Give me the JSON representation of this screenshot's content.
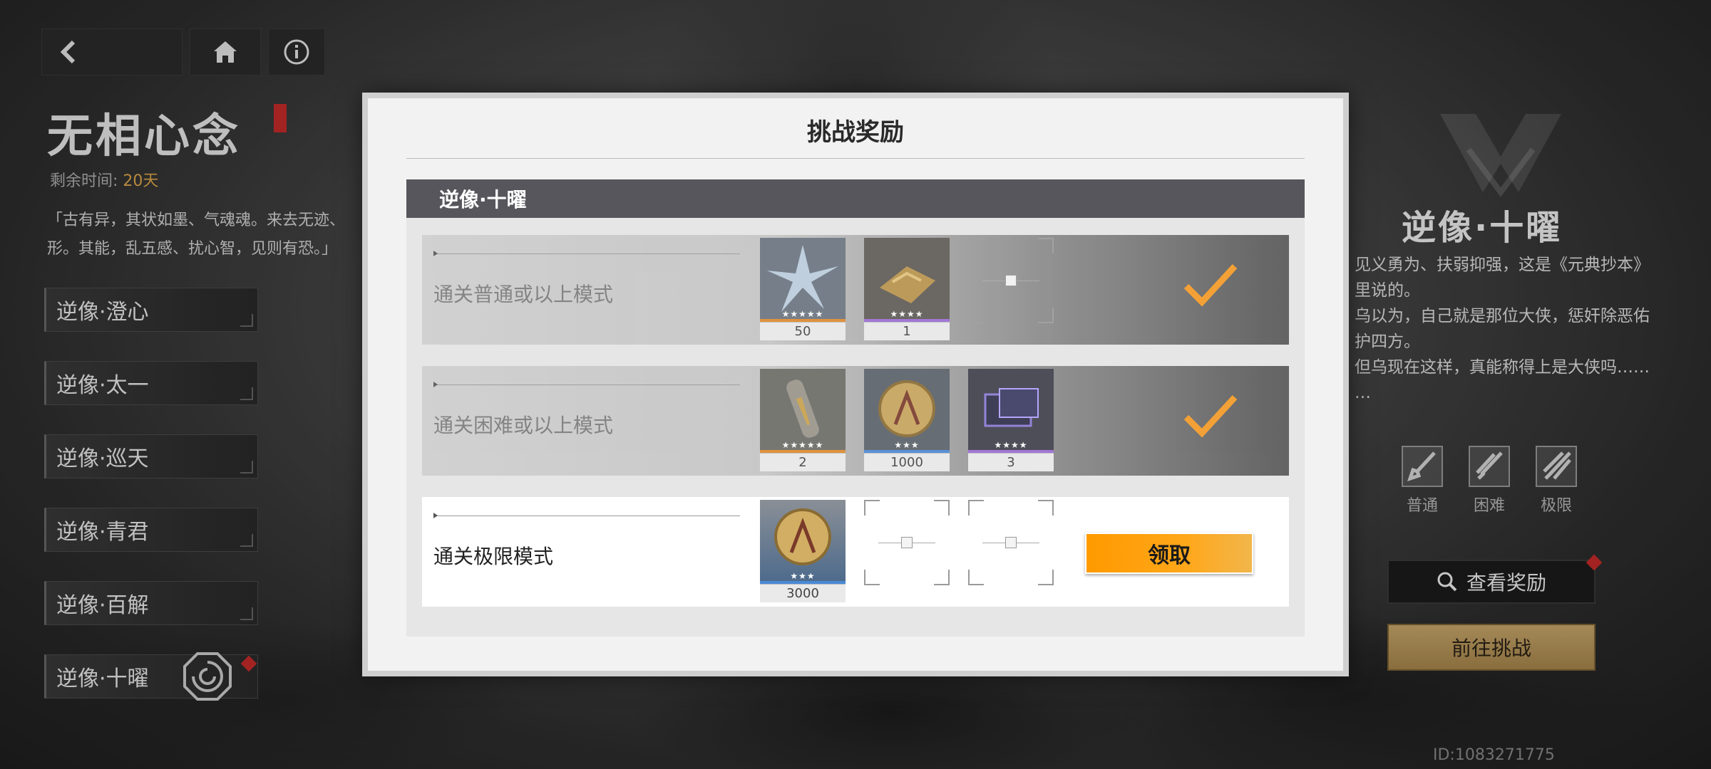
{
  "left_panel": {
    "event_title": "无相心念",
    "remaining_label": "剩余时间:",
    "remaining_value": "20天",
    "lore": "「古有异，其状如墨、气魂魂。来去无迹、形。其能，乱五感、扰心智，见则有恐。」",
    "stages": [
      {
        "label": "逆像·澄心"
      },
      {
        "label": "逆像·太一"
      },
      {
        "label": "逆像·巡天"
      },
      {
        "label": "逆像·青君"
      },
      {
        "label": "逆像·百解"
      },
      {
        "label": "逆像·十曜"
      }
    ]
  },
  "right_panel": {
    "boss_title": "逆像·十曜",
    "description": "见义勇为、扶弱抑强，这是《元典抄本》里说的。\n乌以为，自己就是那位大侠，惩奸除恶佑护四方。\n但乌现在这样，真能称得上是大侠吗……\n…",
    "difficulties": [
      {
        "label": "普通"
      },
      {
        "label": "困难"
      },
      {
        "label": "极限"
      }
    ],
    "view_rewards_label": "查看奖励",
    "go_challenge_label": "前往挑战",
    "uid": "ID:1083271775"
  },
  "modal": {
    "title": "挑战奖励",
    "section_title": "逆像·十曜",
    "rows": [
      {
        "label": "通关普通或以上模式",
        "status": "claimed",
        "items": [
          {
            "name": "crystal-shard",
            "count": "50",
            "stars": "★★★★★",
            "rarity_color": "#e08a2a"
          },
          {
            "name": "gold-material",
            "count": "1",
            "stars": "★★★★",
            "rarity_color": "#9b6bd6"
          }
        ]
      },
      {
        "label": "通关困难或以上模式",
        "status": "claimed",
        "items": [
          {
            "name": "capsule-item",
            "count": "2",
            "stars": "★★★★★",
            "rarity_color": "#e08a2a"
          },
          {
            "name": "gold-coin",
            "count": "1000",
            "stars": "★★★",
            "rarity_color": "#4a8ad6"
          },
          {
            "name": "exp-chip",
            "count": "3",
            "stars": "★★★★",
            "rarity_color": "#9b6bd6"
          }
        ]
      },
      {
        "label": "通关极限模式",
        "status": "claimable",
        "items": [
          {
            "name": "gold-coin",
            "count": "3000",
            "stars": "★★★",
            "rarity_color": "#4a8ad6"
          }
        ],
        "claim_label": "领取"
      }
    ]
  }
}
